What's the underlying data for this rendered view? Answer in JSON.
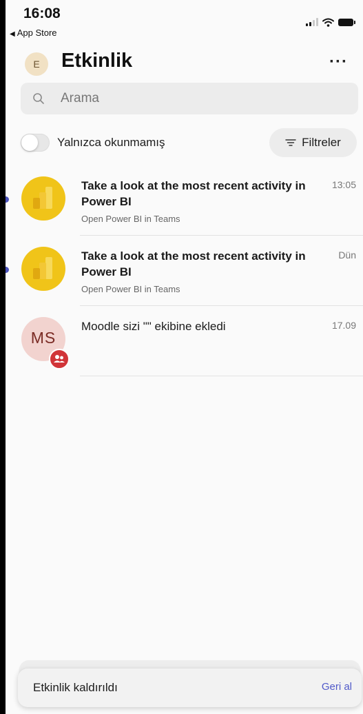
{
  "status_bar": {
    "time": "16:08",
    "back_app": "App Store",
    "icons": [
      "cellular-signal-icon",
      "wifi-icon",
      "battery-icon"
    ]
  },
  "header": {
    "avatar_initial": "E",
    "title": "Etkinlik",
    "more_label": "···"
  },
  "search": {
    "placeholder": "Arama"
  },
  "filters": {
    "toggle_label": "Yalnızca okunmamış",
    "toggle_on": false,
    "filters_label": "Filtreler"
  },
  "feed": [
    {
      "icon": "power-bi-icon",
      "title": "Take a look at the most recent activity in Power BI",
      "subtitle": "Open Power BI in Teams",
      "time": "13:05",
      "unread": true
    },
    {
      "icon": "power-bi-icon",
      "title": "Take a look at the most recent activity in Power BI",
      "subtitle": "Open Power BI in Teams",
      "time": "Dün",
      "unread": true
    },
    {
      "avatar_initials": "MS",
      "title": "Moodle sizi \"\" ekibine ekledi",
      "time": "17.09",
      "unread": false
    }
  ],
  "toast": {
    "message": "Etkinlik kaldırıldı",
    "action": "Geri al"
  },
  "colors": {
    "accent": "#5059c9",
    "unread_dot": "#4b53bc",
    "power_bi_yellow": "#f0c419",
    "badge_red": "#d13438"
  }
}
